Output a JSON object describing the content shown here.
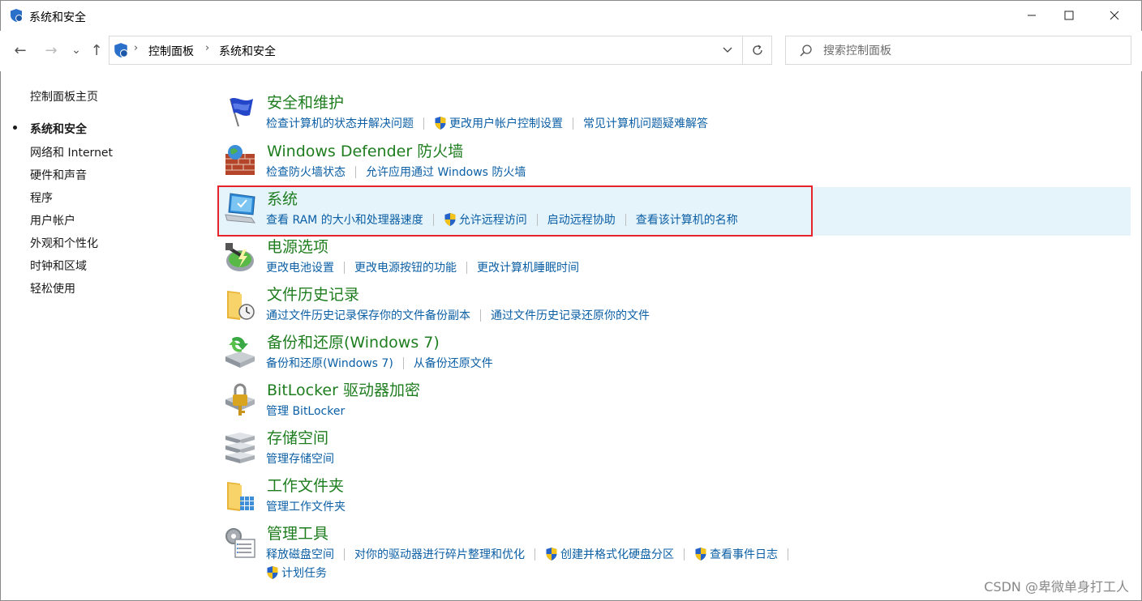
{
  "window": {
    "title": "系统和安全"
  },
  "nav": {
    "back": "←",
    "forward": "→",
    "recent": "⌄",
    "up": "↑"
  },
  "breadcrumb": {
    "items": [
      "控制面板",
      "系统和安全"
    ],
    "separator": "›"
  },
  "search": {
    "placeholder": "搜索控制面板"
  },
  "sidebar": {
    "items": [
      {
        "label": "控制面板主页"
      },
      {
        "label": "系统和安全"
      },
      {
        "label": "网络和 Internet"
      },
      {
        "label": "硬件和声音"
      },
      {
        "label": "程序"
      },
      {
        "label": "用户帐户"
      },
      {
        "label": "外观和个性化"
      },
      {
        "label": "时钟和区域"
      },
      {
        "label": "轻松使用"
      }
    ]
  },
  "categories": [
    {
      "title": "安全和维护",
      "icon": "flag-icon",
      "links": [
        "检查计算机的状态并解决问题",
        "更改用户帐户控制设置",
        "常见计算机问题疑难解答"
      ]
    },
    {
      "title": "Windows Defender 防火墙",
      "icon": "firewall-icon",
      "links": [
        "检查防火墙状态",
        "允许应用通过 Windows 防火墙"
      ]
    },
    {
      "title": "系统",
      "icon": "computer-icon",
      "links": [
        "查看 RAM 的大小和处理器速度",
        "允许远程访问",
        "启动远程协助",
        "查看该计算机的名称"
      ]
    },
    {
      "title": "电源选项",
      "icon": "power-icon",
      "links": [
        "更改电池设置",
        "更改电源按钮的功能",
        "更改计算机睡眠时间"
      ]
    },
    {
      "title": "文件历史记录",
      "icon": "file-history-icon",
      "links": [
        "通过文件历史记录保存你的文件备份副本",
        "通过文件历史记录还原你的文件"
      ]
    },
    {
      "title": "备份和还原(Windows 7)",
      "icon": "backup-icon",
      "links": [
        "备份和还原(Windows 7)",
        "从备份还原文件"
      ]
    },
    {
      "title": "BitLocker 驱动器加密",
      "icon": "bitlocker-icon",
      "links": [
        "管理 BitLocker"
      ]
    },
    {
      "title": "存储空间",
      "icon": "storage-icon",
      "links": [
        "管理存储空间"
      ]
    },
    {
      "title": "工作文件夹",
      "icon": "work-folders-icon",
      "links": [
        "管理工作文件夹"
      ]
    },
    {
      "title": "管理工具",
      "icon": "admin-tools-icon",
      "links": [
        "释放磁盘空间",
        "对你的驱动器进行碎片整理和优化",
        "创建并格式化硬盘分区",
        "查看事件日志",
        "计划任务"
      ]
    }
  ],
  "watermark": "CSDN @卑微单身打工人",
  "colors": {
    "link": "#0b5fa5",
    "category_title": "#1e7d1e",
    "highlight_bg": "#e5f3fb",
    "annotation_box": "#e8242a"
  }
}
